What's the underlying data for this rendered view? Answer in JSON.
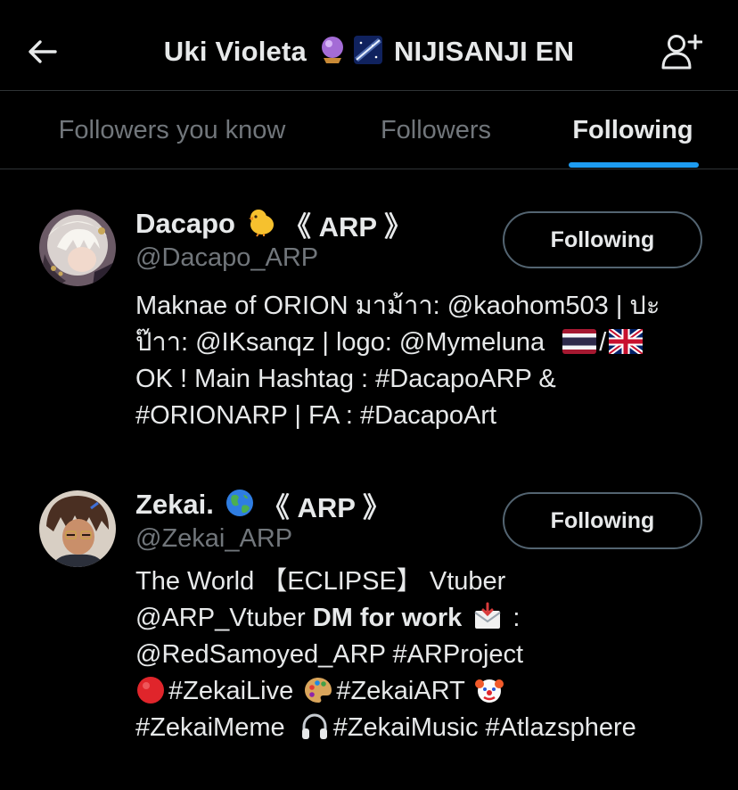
{
  "header": {
    "title_name": "Uki Violeta",
    "title_org": "NIJISANJI EN",
    "icons": [
      "back-arrow-icon",
      "crystal-ball-icon",
      "milky-way-icon",
      "add-user-icon"
    ]
  },
  "tabs": [
    {
      "label": "Followers you know",
      "active": false
    },
    {
      "label": "Followers",
      "active": false
    },
    {
      "label": "Following",
      "active": true
    }
  ],
  "colors": {
    "background": "#000000",
    "text_primary": "#e7e9ea",
    "text_secondary": "#71767b",
    "accent": "#1d9bf0",
    "border": "#536471"
  },
  "users": [
    {
      "name": "Dacapo",
      "name_suffix": "《 ARP 》",
      "name_icon": "chick-icon",
      "handle": "@Dacapo_ARP",
      "button_label": "Following",
      "bio": {
        "line1": "Maknae of ORION มาม้าา: @kaohom503 | ปะ",
        "line2a": "ป๊าา: @IKsanqz | logo: @Mymeluna",
        "line2b": "/",
        "line3": "OK ! Main Hashtag : #DacapoARP &",
        "line4": "#ORIONARP | FA : #DacapoArt"
      }
    },
    {
      "name": "Zekai.",
      "name_suffix": "《 ARP 》",
      "name_icon": "globe-icon",
      "handle": "@Zekai_ARP",
      "button_label": "Following",
      "bio": {
        "line1": "The World 【ECLIPSE】 Vtuber",
        "line2a": "@ARP_Vtuber ",
        "line2b": "DM for work",
        "line2c": " :",
        "line3": "@RedSamoyed_ARP #ARProject",
        "line4a": "#ZekaiLive",
        "line4b": "#ZekaiART",
        "line5a": "#ZekaiMeme",
        "line5b": "#ZekaiMusic #Atlazsphere"
      }
    }
  ]
}
